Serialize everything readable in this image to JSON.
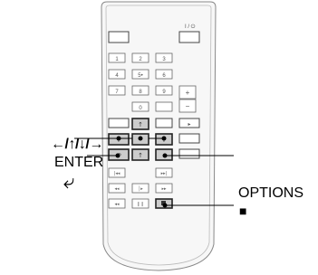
{
  "remote": {
    "power_label": "I / ⏻",
    "number_keys": [
      "1",
      "2",
      "3",
      "4",
      "5",
      "6",
      "7",
      "8",
      "9",
      "0"
    ],
    "five_dot": "5•",
    "plus_label": "+",
    "minus_label": "−",
    "play_symbol": "▸",
    "prev_symbol": "⧏◂◂",
    "next_symbol": "▸▸⧐",
    "rew_symbol": "◂◂",
    "ff_symbol": "▸▸",
    "slow_symbol": "│▸",
    "pause_symbol": "❙❙",
    "replay_symbol": "◂◂"
  },
  "callouts": {
    "arrows": "←/↑/↓/→",
    "enter": "ENTER",
    "return": "⤶",
    "options": "OPTIONS",
    "stop": "■"
  }
}
